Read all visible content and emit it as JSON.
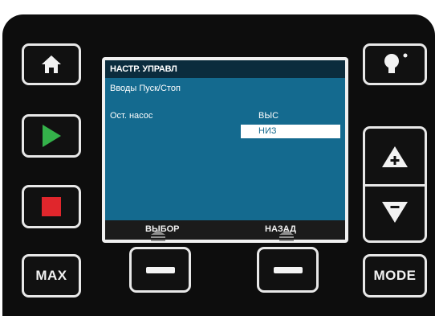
{
  "screen": {
    "title": "НАСТР. УПРАВЛ",
    "subtitle": "Вводы Пуск/Стоп",
    "parameter_label": "Ост. насос",
    "options": [
      "ВЫС",
      "НИЗ"
    ],
    "selected_option": "НИЗ"
  },
  "softkeys": {
    "left_label": "ВЫБОР",
    "right_label": "НАЗАД"
  },
  "buttons": {
    "max_label": "MAX",
    "mode_label": "MODE",
    "up_symbol": "+",
    "down_symbol": "−"
  },
  "colors": {
    "screen_bg": "#146a8f",
    "title_bar": "#0b2c3d",
    "play_green": "#34b24a",
    "stop_red": "#e0262c"
  },
  "icons": [
    "home-icon",
    "play-icon",
    "stop-icon",
    "light-bulb-icon",
    "up-arrow-icon",
    "down-arrow-icon",
    "dash-icon"
  ]
}
